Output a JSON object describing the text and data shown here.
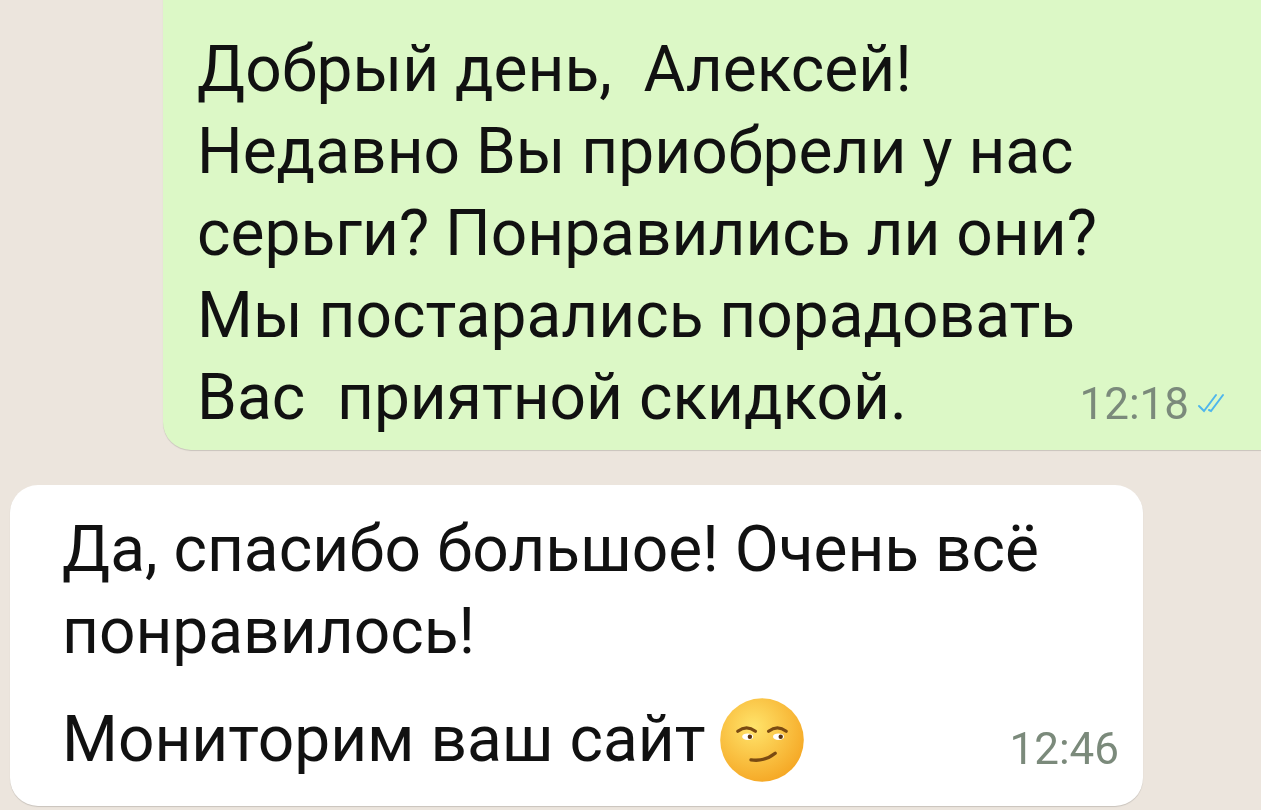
{
  "messages": [
    {
      "kind": "outgoing",
      "paragraphs": [
        [
          "Добрый день,  Алексей!",
          "Недавно Вы приобрели у нас",
          "серьги? Понравились ли они?",
          "Мы постарались порадовать",
          "Вас  приятной скидкой."
        ]
      ],
      "time": "12:18",
      "read": true
    },
    {
      "kind": "incoming",
      "paragraphs": [
        [
          "Да, спасибо большое! Очень всё",
          "понравилось!"
        ],
        [
          "Мониторим ваш сайт"
        ]
      ],
      "emoji": true,
      "time": "12:46"
    }
  ]
}
